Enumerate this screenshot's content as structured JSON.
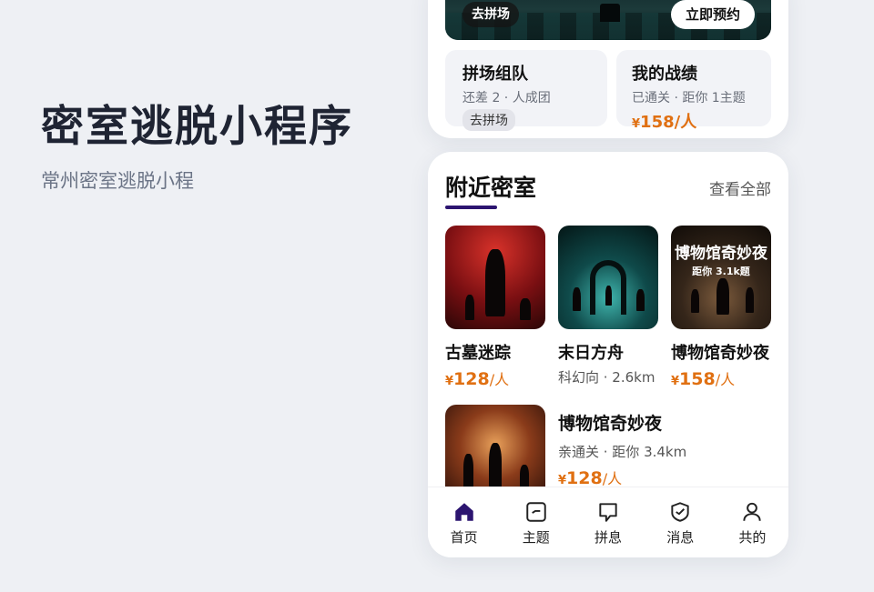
{
  "hero": {
    "title": "密室逃脱小程序",
    "subtitle": "常州密室逃脱小程"
  },
  "banner": {
    "tag": "去拼场",
    "cta": "立即预约"
  },
  "mini_cards": [
    {
      "title": "拼场组队",
      "sub": "还差 2 · 人成团",
      "pill": "去拼场"
    },
    {
      "title": "我的战绩",
      "sub": "已通关 · 距你 1主题",
      "price_symbol": "¥",
      "price": "158",
      "unit": "/人"
    }
  ],
  "nearby": {
    "title": "附近密室",
    "more": "查看全部",
    "rooms": [
      {
        "name": "古墓迷踪",
        "price_symbol": "¥",
        "price": "128",
        "unit": "/人",
        "theme": "red"
      },
      {
        "name": "末日方舟",
        "meta": "科幻向 · 2.6km",
        "theme": "teal"
      },
      {
        "name": "博物馆奇妙夜",
        "price_symbol": "¥",
        "price": "158",
        "unit": "/人",
        "thumb_title": "博物馆奇妙夜",
        "thumb_sub": "距你 3.1k题",
        "theme": "brown"
      }
    ],
    "featured": {
      "name": "博物馆奇妙夜",
      "meta": "亲通关 · 距你 3.4km",
      "price_symbol": "¥",
      "price": "128",
      "unit": "/人"
    }
  },
  "tabbar": [
    {
      "label": "首页",
      "icon": "home-icon",
      "active": true
    },
    {
      "label": "主题",
      "icon": "ticket-icon"
    },
    {
      "label": "拼息",
      "icon": "chat-icon"
    },
    {
      "label": "消息",
      "icon": "shield-check-icon"
    },
    {
      "label": "共的",
      "icon": "user-icon"
    }
  ],
  "colors": {
    "accent": "#2c1570",
    "price": "#e07012",
    "title": "#1f2433"
  }
}
